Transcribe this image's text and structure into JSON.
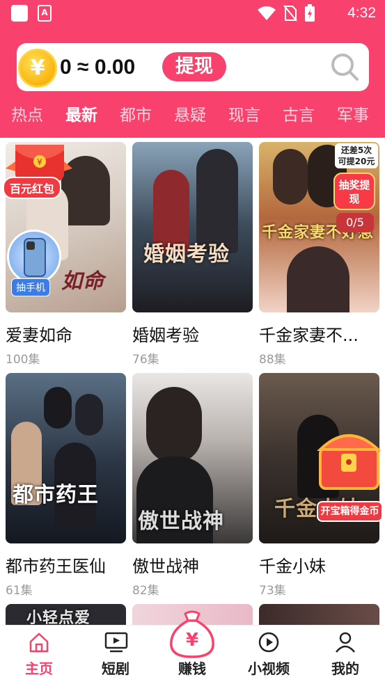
{
  "status_bar": {
    "time": "4:32"
  },
  "header": {
    "coin_symbol": "¥",
    "balance_text": "0 ≈ 0.00",
    "withdraw_label": "提现",
    "search_icon": "search-icon"
  },
  "tabs": [
    {
      "label": "热点",
      "active": false
    },
    {
      "label": "最新",
      "active": true
    },
    {
      "label": "都市",
      "active": false
    },
    {
      "label": "悬疑",
      "active": false
    },
    {
      "label": "现言",
      "active": false
    },
    {
      "label": "古言",
      "active": false
    },
    {
      "label": "军事",
      "active": false
    }
  ],
  "dramas": [
    {
      "title": "爱妻如命",
      "episodes": "100集",
      "poster_text": "如命"
    },
    {
      "title": "婚姻考验",
      "episodes": "76集",
      "poster_text": "婚姻考验"
    },
    {
      "title": "千金家妻不...",
      "episodes": "88集",
      "poster_text": "千金家妻不好惹"
    },
    {
      "title": "都市药王医仙",
      "episodes": "61集",
      "poster_text": "都市药王"
    },
    {
      "title": "傲世战神",
      "episodes": "82集",
      "poster_text": "傲世战神"
    },
    {
      "title": "千金小妹",
      "episodes": "73集",
      "poster_text": "千金小妹"
    }
  ],
  "partial_row": {
    "poster_text": "小轻点爱"
  },
  "badges": {
    "red_envelope": "百元红包",
    "phone_prize": "抽手机",
    "draw_tip_line1": "还差5次",
    "draw_tip_line2": "可提20元",
    "draw_button": "抽奖提现",
    "draw_progress": "0/5",
    "treasure_chest": "开宝箱得金币"
  },
  "bottom_nav": [
    {
      "label": "主页",
      "icon": "home-icon",
      "active": true
    },
    {
      "label": "短剧",
      "icon": "tv-icon",
      "active": false
    },
    {
      "label": "赚钱",
      "icon": "money-bag-icon",
      "active": false
    },
    {
      "label": "小视频",
      "icon": "play-icon",
      "active": false
    },
    {
      "label": "我的",
      "icon": "user-icon",
      "active": false
    }
  ],
  "colors": {
    "brand": "#f8416c",
    "coin": "#f9b50f"
  }
}
